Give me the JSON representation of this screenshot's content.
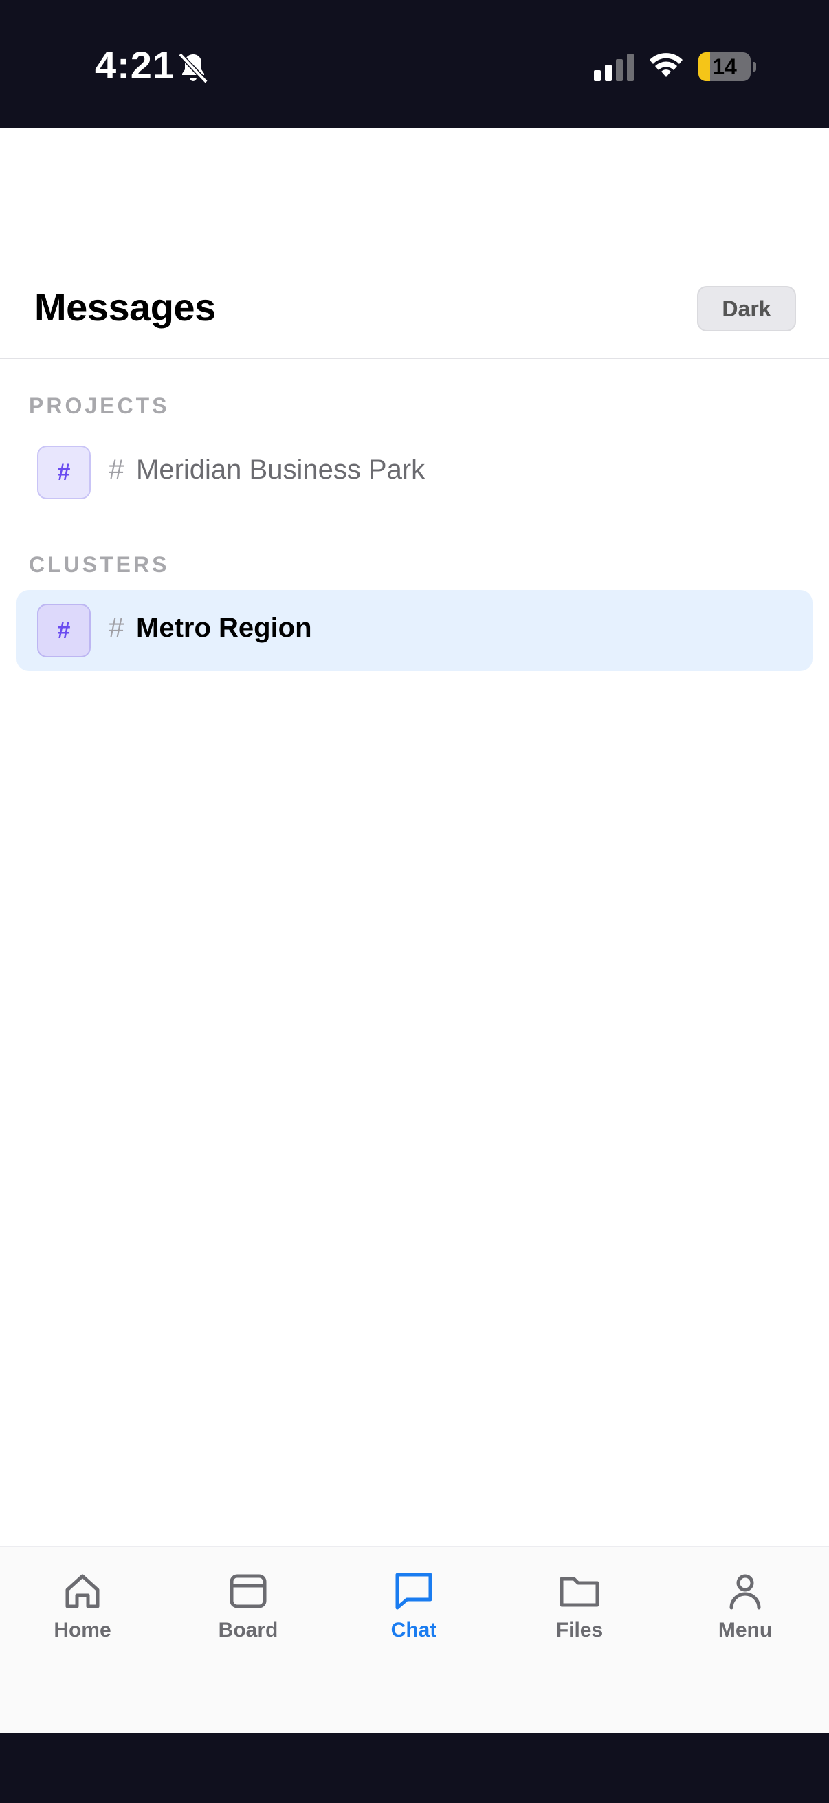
{
  "status_bar": {
    "time": "4:21",
    "battery_level": "14",
    "battery_fraction": 0.14,
    "icons": [
      "bell-slash-icon",
      "cellular-signal-icon",
      "wifi-icon",
      "battery-icon"
    ]
  },
  "header": {
    "title": "Messages",
    "theme_toggle_label": "Dark"
  },
  "sections": [
    {
      "label": "PROJECTS",
      "channels": [
        {
          "avatar": "#",
          "hash": "#",
          "name": "Meridian Business Park",
          "selected": false
        }
      ]
    },
    {
      "label": "CLUSTERS",
      "channels": [
        {
          "avatar": "#",
          "hash": "#",
          "name": "Metro Region",
          "selected": true
        }
      ]
    }
  ],
  "tab_bar": {
    "active": "Chat",
    "tabs": [
      {
        "label": "Home",
        "icon": "home-icon"
      },
      {
        "label": "Board",
        "icon": "board-icon"
      },
      {
        "label": "Chat",
        "icon": "chat-icon"
      },
      {
        "label": "Files",
        "icon": "folder-icon"
      },
      {
        "label": "Menu",
        "icon": "person-icon"
      }
    ]
  },
  "colors": {
    "accent": "#1a7cf0",
    "selected_row": "#e6f1fe",
    "avatar_text": "#6a4cf0",
    "system_bar": "#10101e",
    "battery_low": "#f5c518"
  }
}
